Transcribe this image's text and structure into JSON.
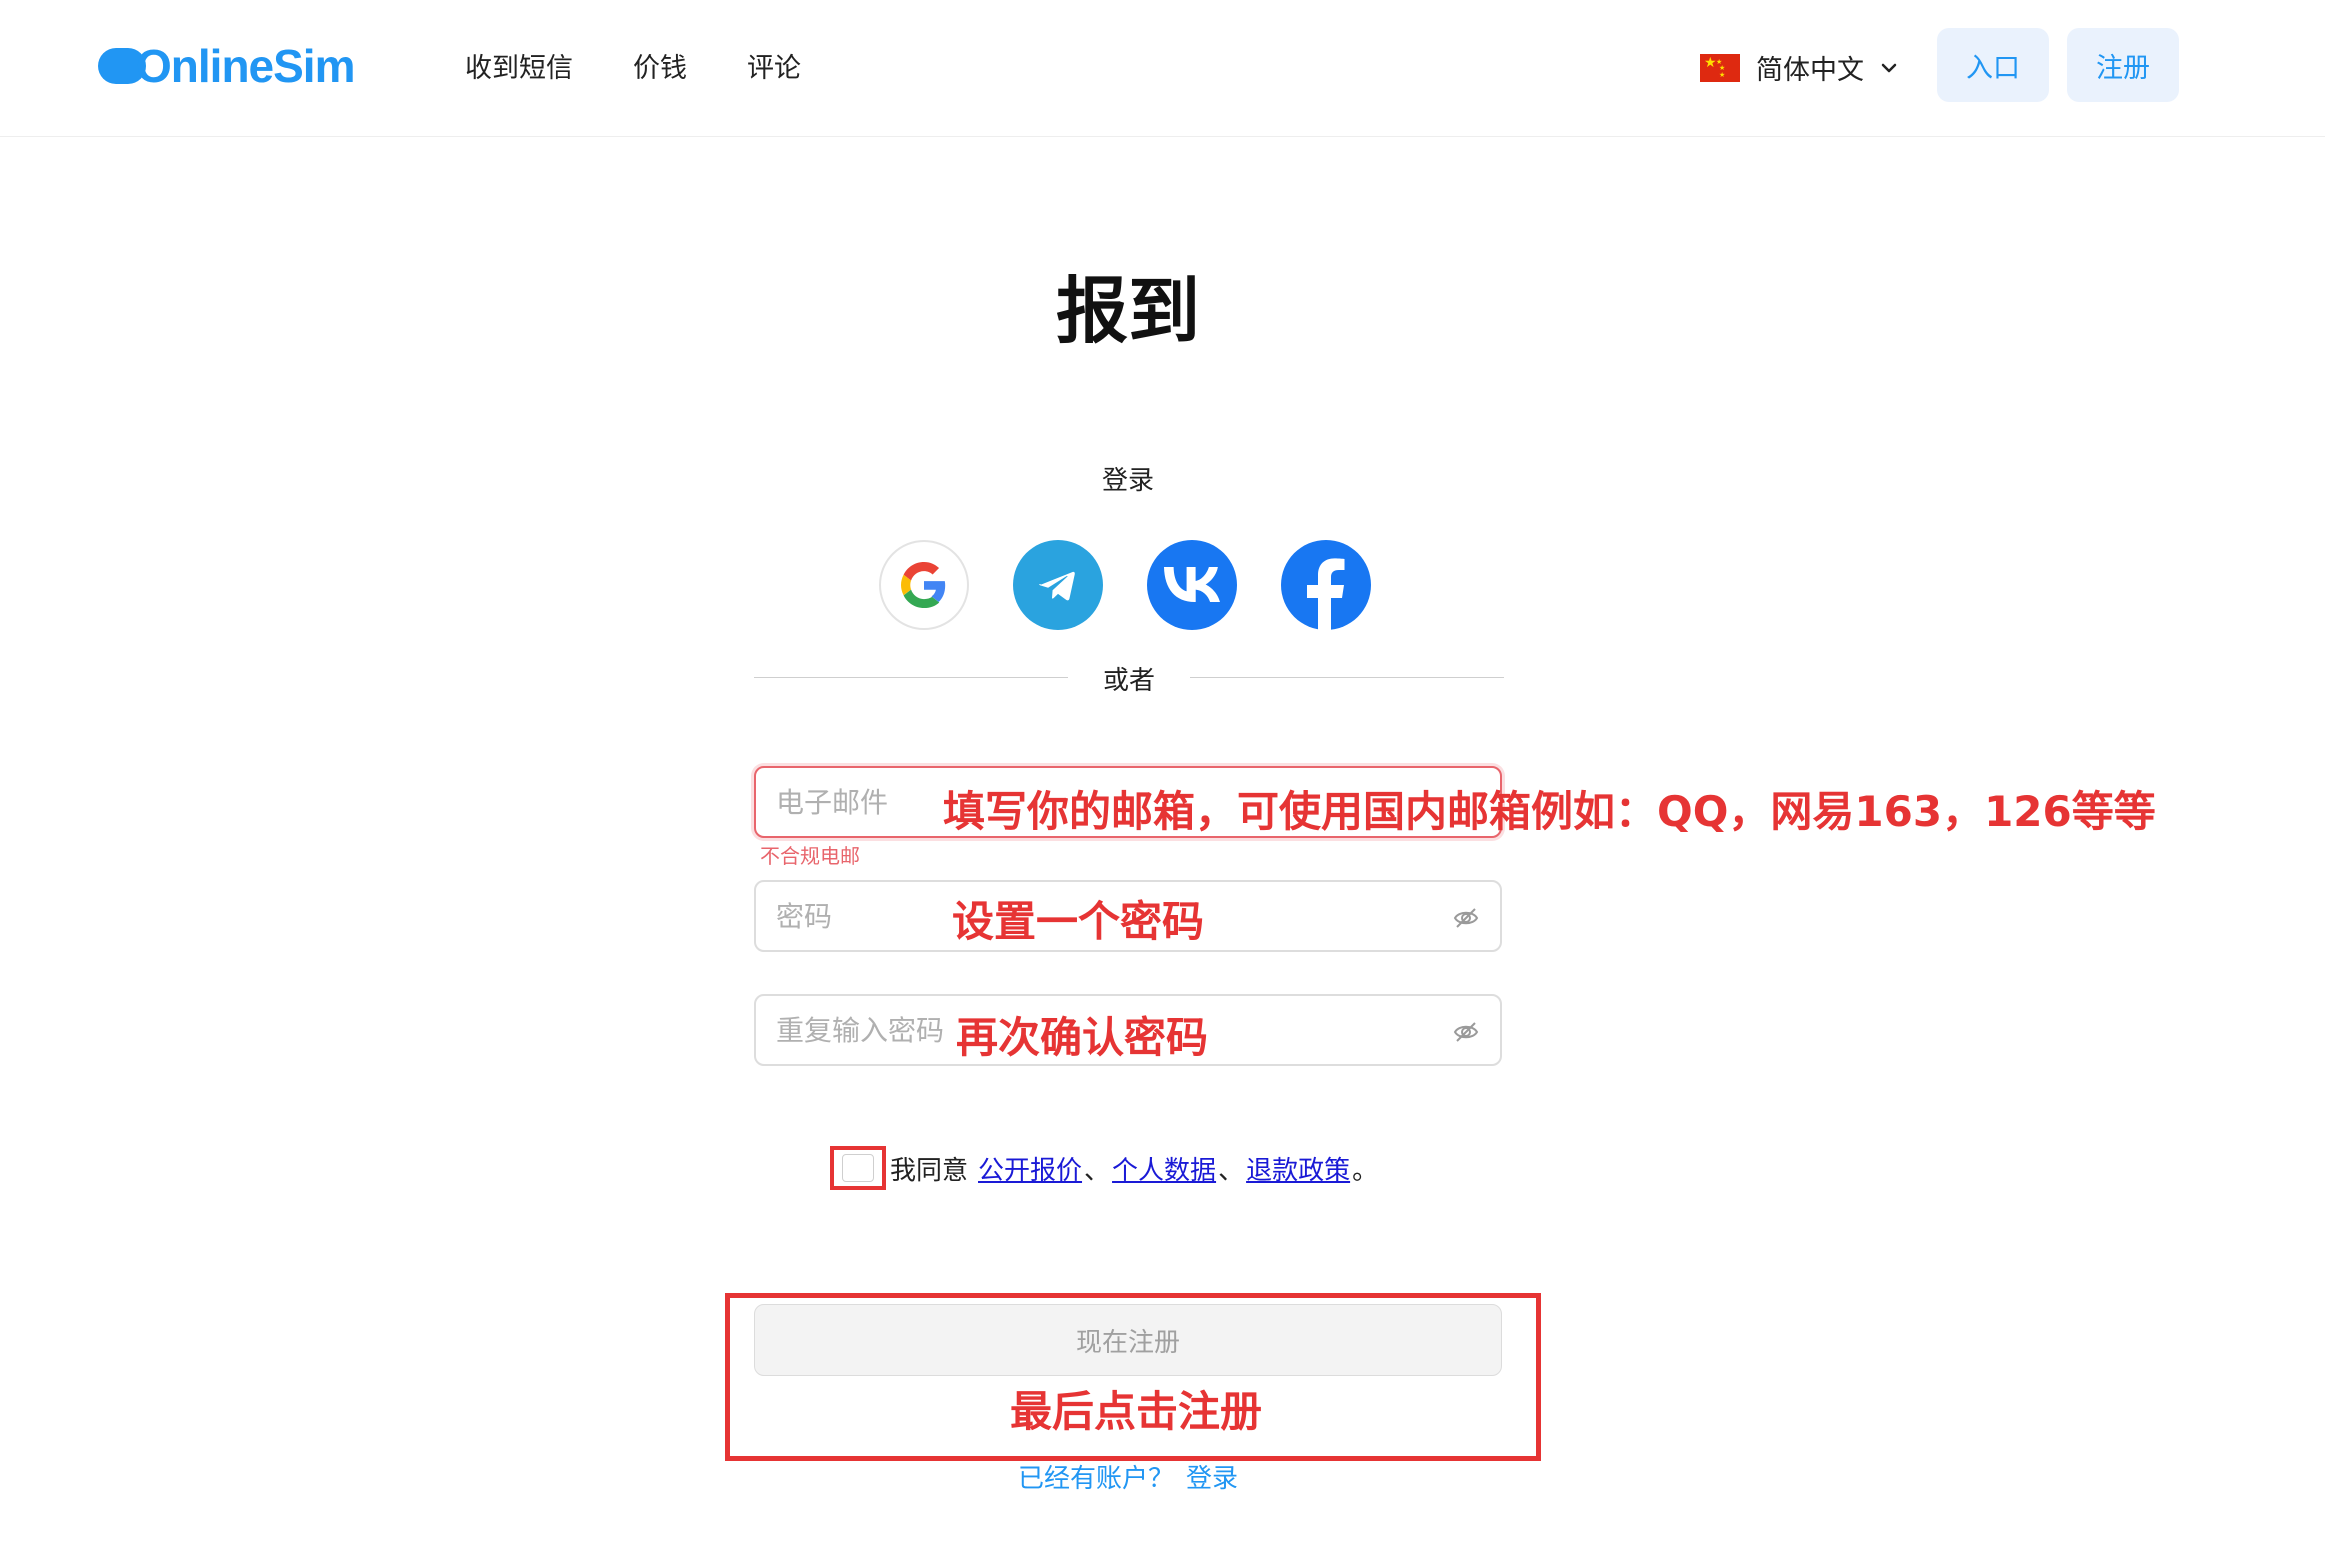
{
  "header": {
    "logo_text": "OnlineSim",
    "nav": [
      {
        "label": "收到短信"
      },
      {
        "label": "价钱"
      },
      {
        "label": "评论"
      }
    ],
    "language": {
      "label": "简体中文",
      "flag": "china-flag-icon"
    },
    "login_button": "入口",
    "register_button": "注册",
    "accent_color": "#2196f3"
  },
  "form": {
    "title": "报到",
    "login_with": "登录",
    "socials": [
      "google-icon",
      "telegram-icon",
      "vk-icon",
      "facebook-icon"
    ],
    "or_text": "或者",
    "email": {
      "placeholder": "电子邮件",
      "value": "",
      "error": "不合规电邮"
    },
    "password": {
      "placeholder": "密码",
      "value": ""
    },
    "repeat_password": {
      "placeholder": "重复输入密码",
      "value": ""
    },
    "agree": {
      "prefix": "我同意",
      "links": [
        "公开报价",
        "个人数据",
        "退款政策"
      ],
      "separator": "、",
      "suffix": "。"
    },
    "submit": "现在注册",
    "have_account": "已经有账户？",
    "login_link": "登录"
  },
  "annotations": {
    "email_note": "填写你的邮箱，可使用国内邮箱例如：QQ，网易163，126等等",
    "password_note": "设置一个密码",
    "repeat_note": "再次确认密码",
    "submit_note": "最后点击注册",
    "color": "#e63434"
  }
}
